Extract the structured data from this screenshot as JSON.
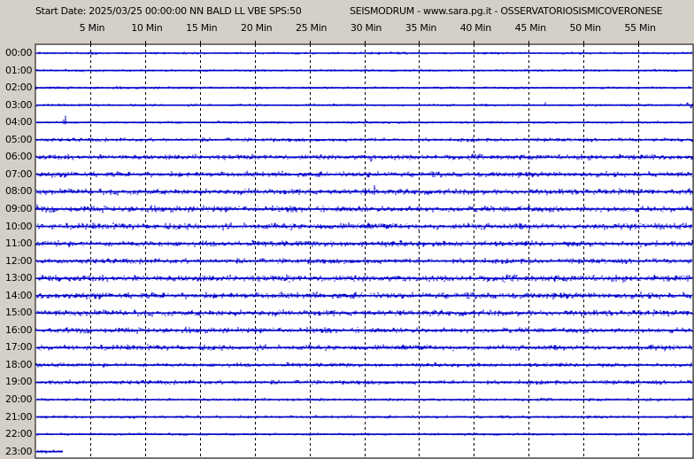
{
  "header": {
    "start_date": "Start Date: 2025/03/25 00:00:00 NN BALD LL VBE SPS:50",
    "title": "SEISMODRUM - www.sara.pg.it - OSSERVATORIOSISMICOVERONESE"
  },
  "colors": {
    "background": "#d4d0c8",
    "plot_background": "#ffffff",
    "trace": "#0000cc",
    "grid": "#000000"
  },
  "chart_data": {
    "type": "line",
    "description_of_axes": "helicorder",
    "x_ticks": [
      "5 Min",
      "10 Min",
      "15 Min",
      "20 Min",
      "25 Min",
      "30 Min",
      "35 Min",
      "40 Min",
      "45 Min",
      "50 Min",
      "55 Min"
    ],
    "x_tick_values": [
      5,
      10,
      15,
      20,
      25,
      30,
      35,
      40,
      45,
      50,
      55
    ],
    "xlim": [
      0,
      60
    ],
    "grid": true,
    "rows": [
      {
        "label": "00:00",
        "noise": 1.2,
        "events": []
      },
      {
        "label": "01:00",
        "noise": 1.2,
        "events": []
      },
      {
        "label": "02:00",
        "noise": 1.3,
        "events": []
      },
      {
        "label": "03:00",
        "noise": 1.2,
        "events": [
          {
            "minute": 46.5,
            "amp": 4
          },
          {
            "minute": 59.6,
            "amp": 9
          }
        ]
      },
      {
        "label": "04:00",
        "noise": 1.3,
        "events": [
          {
            "minute": 2.7,
            "amp": 11
          }
        ]
      },
      {
        "label": "05:00",
        "noise": 1.8,
        "events": [
          {
            "minute": 47.0,
            "amp": 3
          },
          {
            "minute": 59.5,
            "amp": 3
          }
        ]
      },
      {
        "label": "06:00",
        "noise": 2.5,
        "events": [
          {
            "minute": 30.7,
            "amp": 8
          }
        ]
      },
      {
        "label": "07:00",
        "noise": 2.5,
        "events": [
          {
            "minute": 30.5,
            "amp": 6
          }
        ]
      },
      {
        "label": "08:00",
        "noise": 2.7,
        "events": [
          {
            "minute": 30.9,
            "amp": 10
          }
        ]
      },
      {
        "label": "09:00",
        "noise": 2.8,
        "events": [
          {
            "minute": 0.1,
            "amp": 7
          },
          {
            "minute": 44.9,
            "amp": 6
          },
          {
            "minute": 31.0,
            "amp": 4
          }
        ]
      },
      {
        "label": "10:00",
        "noise": 2.9,
        "events": [
          {
            "minute": 0.5,
            "amp": 5
          },
          {
            "minute": 4.6,
            "amp": 4
          }
        ]
      },
      {
        "label": "11:00",
        "noise": 2.7,
        "events": [
          {
            "minute": 27.0,
            "amp": 6
          },
          {
            "minute": 32.5,
            "amp": 5
          }
        ]
      },
      {
        "label": "12:00",
        "noise": 2.4,
        "events": []
      },
      {
        "label": "13:00",
        "noise": 3.0,
        "events": [
          {
            "minute": 4.3,
            "amp": 6
          },
          {
            "minute": 14.8,
            "amp": 7
          },
          {
            "minute": 20.0,
            "amp": 5
          }
        ]
      },
      {
        "label": "14:00",
        "noise": 2.9,
        "events": [
          {
            "minute": 25.5,
            "amp": 5
          }
        ]
      },
      {
        "label": "15:00",
        "noise": 2.8,
        "events": []
      },
      {
        "label": "16:00",
        "noise": 2.5,
        "events": []
      },
      {
        "label": "17:00",
        "noise": 2.5,
        "events": [
          {
            "minute": 56.2,
            "amp": 6
          }
        ]
      },
      {
        "label": "18:00",
        "noise": 2.0,
        "events": []
      },
      {
        "label": "19:00",
        "noise": 2.0,
        "events": []
      },
      {
        "label": "20:00",
        "noise": 1.5,
        "events": []
      },
      {
        "label": "21:00",
        "noise": 1.4,
        "events": []
      },
      {
        "label": "22:00",
        "noise": 1.3,
        "events": []
      },
      {
        "label": "23:00",
        "noise": 1.6,
        "events": [],
        "end_minute": 2.5
      }
    ]
  }
}
